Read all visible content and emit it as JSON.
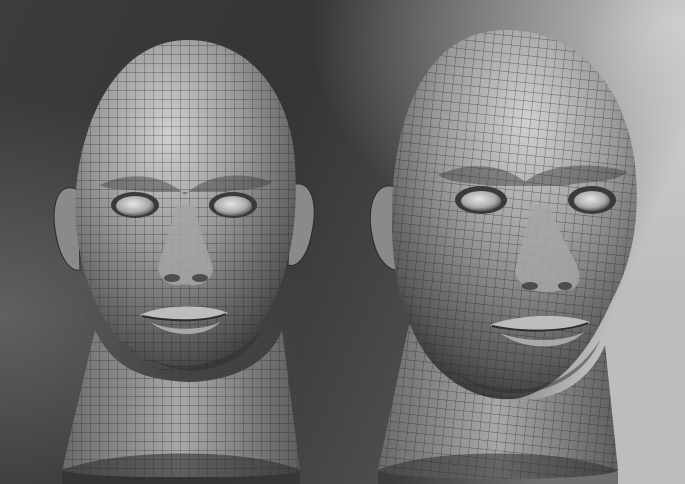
{
  "scene": {
    "background_colors": [
      "#2e2e2e",
      "#4a4a4a",
      "#7a7a7a",
      "#b8b8b8"
    ],
    "material_colors": {
      "base": "#8d8d8d",
      "highlight": "#d2d2d2",
      "shadow": "#3c3c3c",
      "wire": "#1e1e1e"
    },
    "models": [
      {
        "name": "head-front-view",
        "icon": "wireframe-head-icon"
      },
      {
        "name": "head-three-quarter-view",
        "icon": "wireframe-head-icon"
      }
    ]
  }
}
